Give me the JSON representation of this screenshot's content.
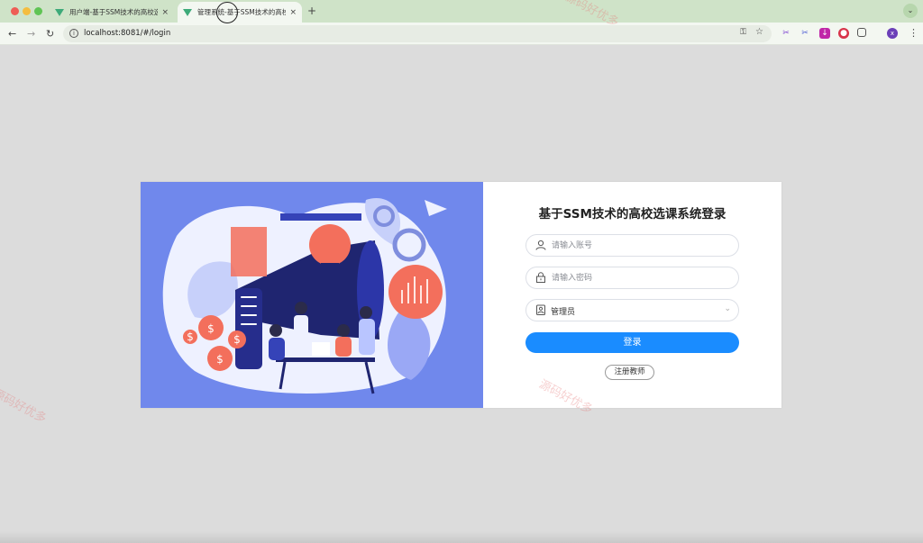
{
  "browser": {
    "tabs": [
      {
        "title": "用户端-基于SSM技术的高校选",
        "close": "×"
      },
      {
        "title": "管理系统-基于SSM技术的高校",
        "close": "×"
      }
    ],
    "new_tab": "+",
    "tab_menu": "⌄",
    "url": "localhost:8081/#/login",
    "profile_initial": "x"
  },
  "login": {
    "title": "基于SSM技术的高校选课系统登录",
    "username_placeholder": "请输入账号",
    "password_placeholder": "请输入密码",
    "role_selected": "管理员",
    "login_button": "登录",
    "register_button": "注册教师"
  },
  "watermark": "源码好优多",
  "colors": {
    "illustration_bg": "#7088ec",
    "primary_button": "#1a8cff",
    "tab_strip": "#cfe3c8"
  }
}
